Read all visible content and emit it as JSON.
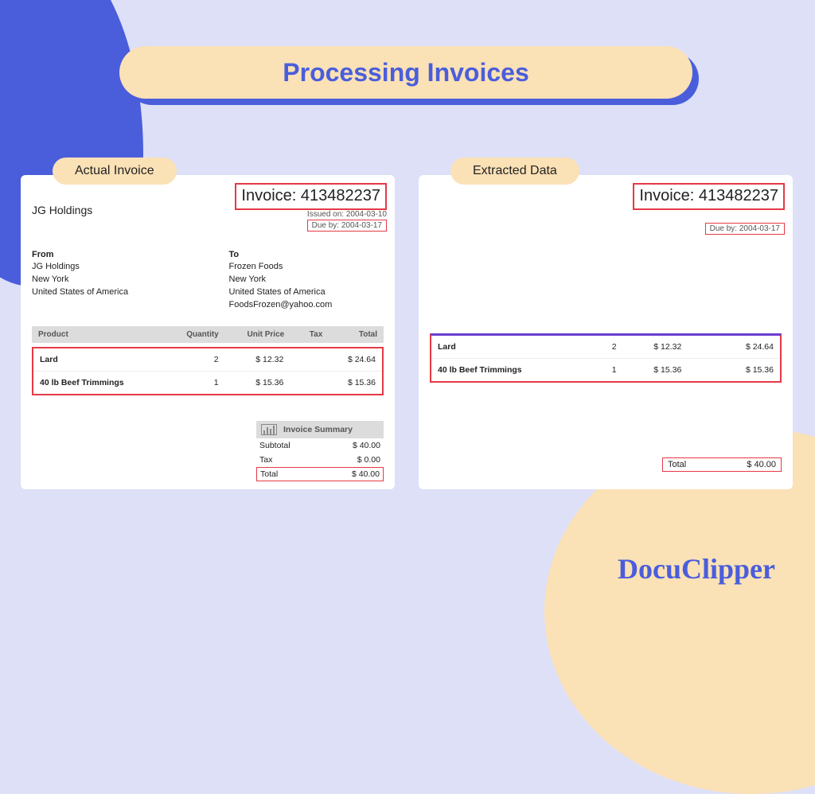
{
  "title": "Processing Invoices",
  "tabs": {
    "left": "Actual Invoice",
    "right": "Extracted Data"
  },
  "invoice": {
    "number_label": "Invoice: 413482237",
    "company": "JG Holdings",
    "issued": "Issued on: 2004-03-10",
    "due": "Due by: 2004-03-17",
    "from_label": "From",
    "from": {
      "l1": "JG Holdings",
      "l2": "New York",
      "l3": "United States of America"
    },
    "to_label": "To",
    "to": {
      "l1": "Frozen Foods",
      "l2": "New York",
      "l3": "United States of America",
      "l4": "FoodsFrozen@yahoo.com"
    },
    "headers": {
      "c1": "Product",
      "c2": "Quantity",
      "c3": "Unit Price",
      "c4": "Tax",
      "c5": "Total"
    },
    "lines": [
      {
        "product": "Lard",
        "qty": "2",
        "price": "$ 12.32",
        "tax": "",
        "total": "$ 24.64"
      },
      {
        "product": "40 lb Beef Trimmings",
        "qty": "1",
        "price": "$ 15.36",
        "tax": "",
        "total": "$ 15.36"
      }
    ],
    "summary": {
      "title": "Invoice Summary",
      "subtotal_label": "Subtotal",
      "subtotal": "$ 40.00",
      "tax_label": "Tax",
      "tax": "$ 0.00",
      "total_label": "Total",
      "total": "$ 40.00"
    }
  },
  "extracted": {
    "total_label": "Total",
    "total": "$ 40.00"
  },
  "brand": "DocuClipper"
}
